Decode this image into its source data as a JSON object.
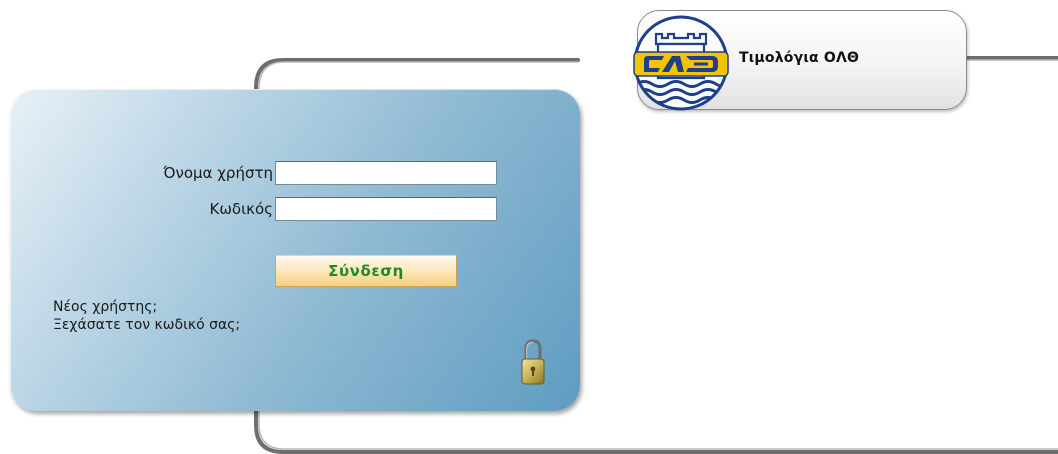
{
  "header": {
    "title": "Τιμολόγια ΟΛΘ",
    "logo_icon": "olth-port-logo-icon",
    "logo_text": "ΟΛΘ"
  },
  "login": {
    "username_label": "Όνομα χρήστη",
    "username_value": "",
    "password_label": "Κωδικός",
    "password_value": "",
    "submit_label": "Σύνδεση",
    "new_user_link": "Νέος χρήστης;",
    "forgot_password_link": "Ξεχάσατε τον κωδικό σας;",
    "lock_icon": "padlock-icon"
  },
  "colors": {
    "panel_start": "#e8f1f7",
    "panel_end": "#5f9cc2",
    "button_text": "#1f8a1f",
    "button_fill": "#f8cf7c",
    "frame_stroke": "#7a7a7a",
    "logo_blue": "#1d3f8c",
    "logo_yellow": "#f5c400"
  }
}
